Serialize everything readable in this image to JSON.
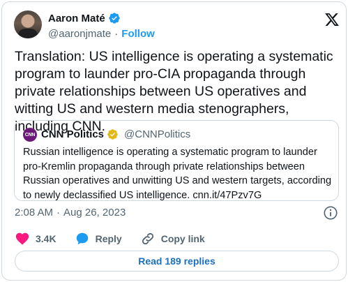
{
  "author": {
    "name": "Aaron Maté",
    "handle": "@aaronjmate",
    "separator": "·",
    "follow_label": "Follow"
  },
  "tweet": {
    "text": "Translation: US intelligence is operating a systematic program to launder pro-CIA propaganda through private relationships between US operatives and witting US and western media stenographers, including CNN."
  },
  "quoted": {
    "avatar_text": "CNN",
    "name": "CNN Politics",
    "handle": "@CNNPolitics",
    "text": "Russian intelligence is operating a systematic program to launder pro-Kremlin propaganda through private relationships between Russian operatives and unwitting US and western targets, according to newly declassified US intelligence. cnn.it/47Pzv7G"
  },
  "meta": {
    "time": "2:08 AM",
    "separator": "·",
    "date": "Aug 26, 2023"
  },
  "actions": {
    "likes": "3.4K",
    "reply_label": "Reply",
    "copy_label": "Copy link"
  },
  "replies_button": "Read 189 replies",
  "colors": {
    "accent": "#1d9bf0",
    "like": "#f91880",
    "verified_gold": "#e2b719",
    "text_secondary": "#536471",
    "border": "#cfd9de"
  },
  "icons": [
    "verified-badge-icon",
    "x-logo-icon",
    "gold-check-badge-icon",
    "info-icon",
    "heart-icon",
    "reply-bubble-icon",
    "link-icon"
  ]
}
